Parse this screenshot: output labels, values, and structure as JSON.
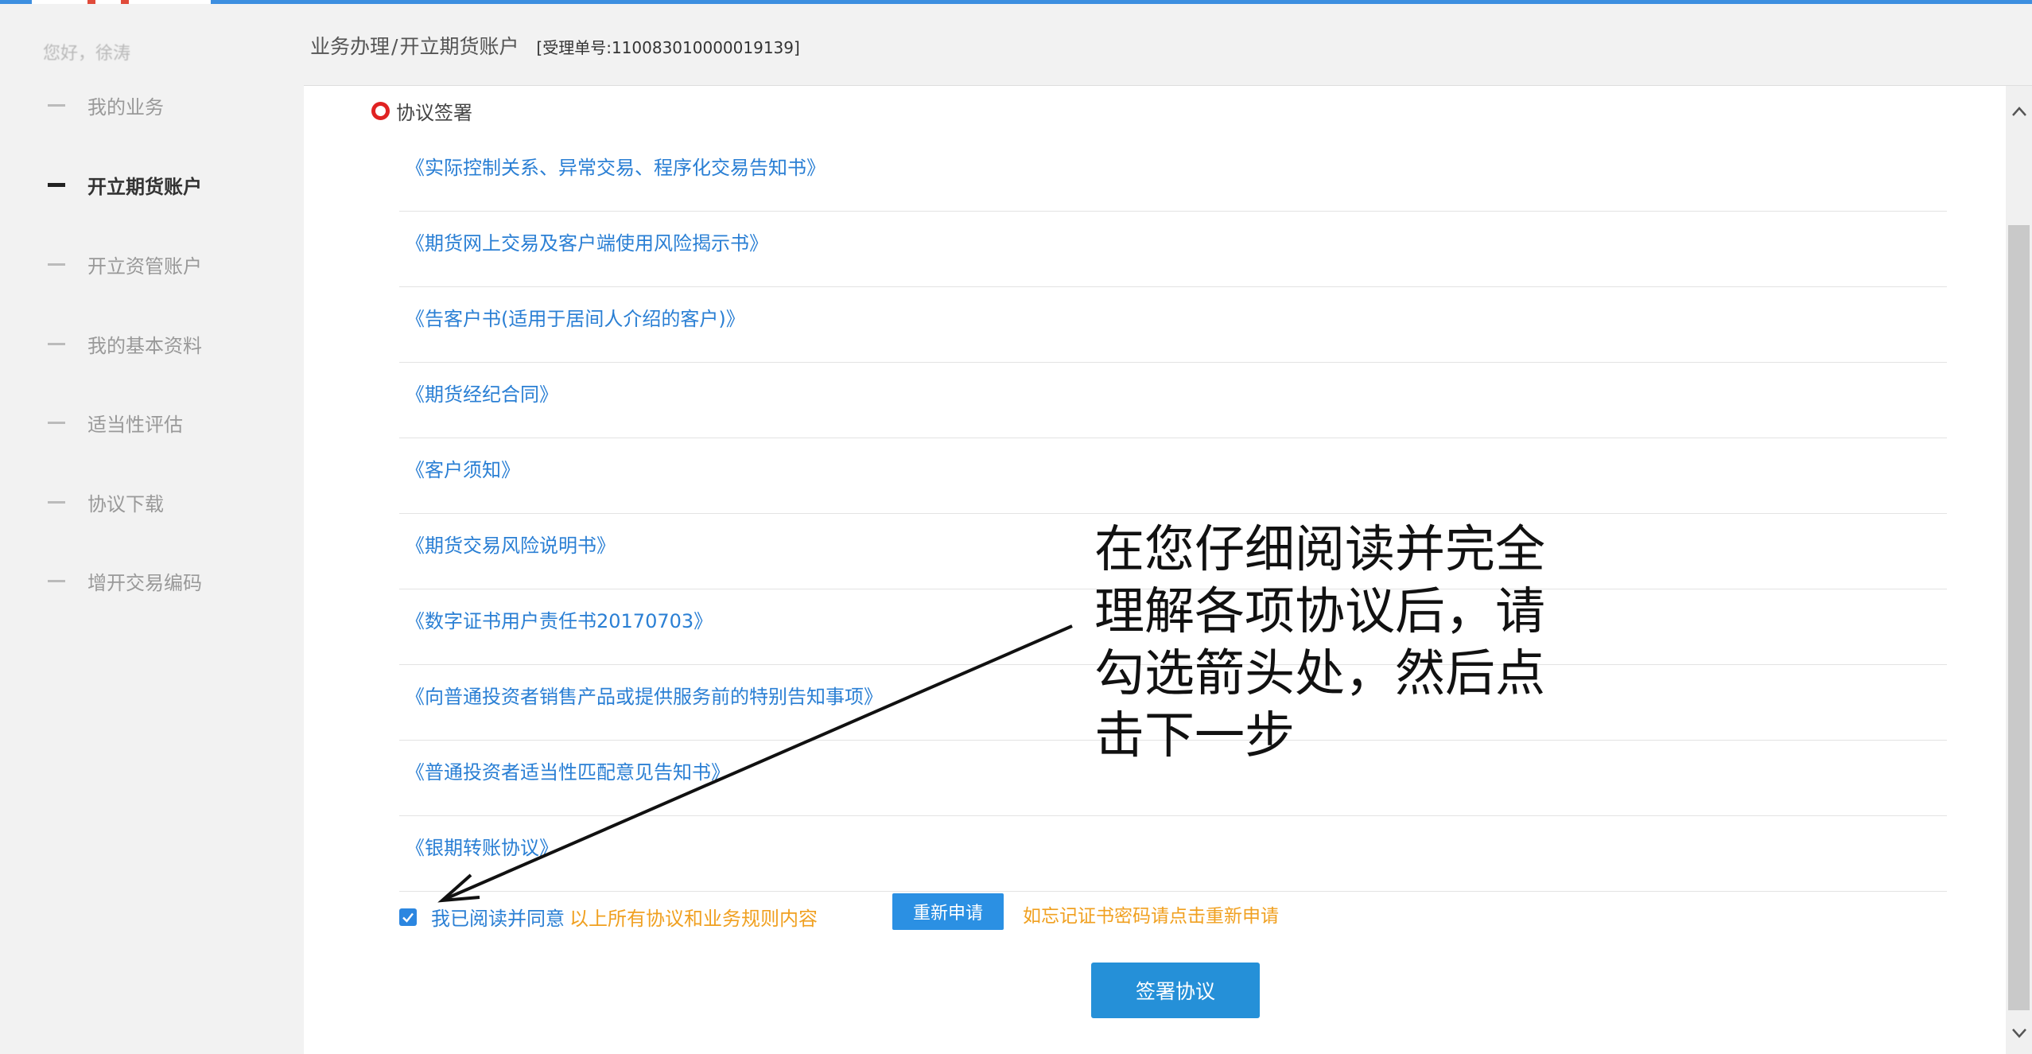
{
  "header": {
    "breadcrumb": [
      "业务办理",
      "开立期货账户"
    ],
    "breadcrumb_sep": "/",
    "ticket": "[受理单号:110083010000019139]"
  },
  "sidebar": {
    "greeting": "您好，徐涛",
    "items": [
      {
        "label": "我的业务",
        "active": false
      },
      {
        "label": "开立期货账户",
        "active": true
      },
      {
        "label": "开立资管账户",
        "active": false
      },
      {
        "label": "我的基本资料",
        "active": false
      },
      {
        "label": "适当性评估",
        "active": false
      },
      {
        "label": "协议下载",
        "active": false
      },
      {
        "label": "增开交易编码",
        "active": false
      }
    ]
  },
  "main": {
    "section_title": "协议签署",
    "agreements": [
      "《实际控制关系、异常交易、程序化交易告知书》",
      "《期货网上交易及客户端使用风险揭示书》",
      "《告客户书(适用于居间人介绍的客户)》",
      "《期货经纪合同》",
      "《客户须知》",
      "《期货交易风险说明书》",
      "《数字证书用户责任书20170703》",
      "《向普通投资者销售产品或提供服务前的特别告知事项》",
      "《普通投资者适当性匹配意见告知书》",
      "《银期转账协议》"
    ],
    "agree_checked": true,
    "agree_label": "我已阅读并同意",
    "agree_highlight": "以上所有协议和业务规则内容",
    "reapply_button": "重新申请",
    "reapply_tip": "如忘记证书密码请点击重新申请",
    "sign_button": "签署协议"
  },
  "annotation": {
    "lines": [
      "在您仔细阅读并完全",
      "理解各项协议后，请",
      "勾选箭头处，然后点",
      "击下一步"
    ]
  },
  "colors": {
    "accent": "#3d8fe0",
    "link": "#2a7fd4",
    "highlight": "#f0a020",
    "button": "#2590d8",
    "marker": "#e02222"
  },
  "icons": {
    "checkbox": "check-icon",
    "scroll_up": "chevron-up-icon",
    "scroll_down": "chevron-down-icon",
    "section_marker": "circle-marker-icon"
  }
}
